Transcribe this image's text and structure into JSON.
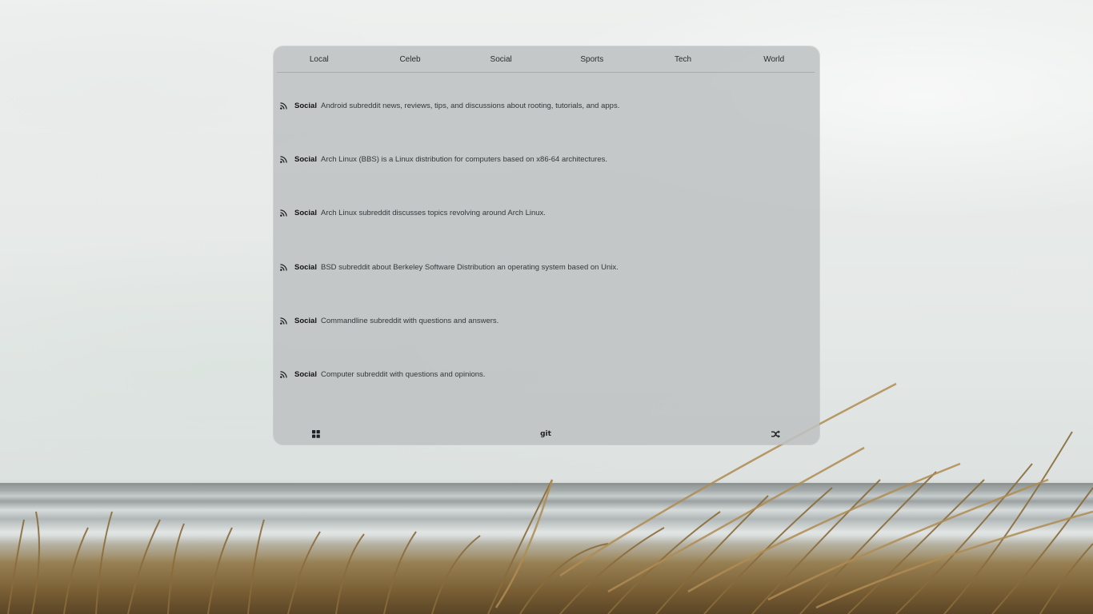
{
  "tabs": [
    {
      "label": "Local"
    },
    {
      "label": "Celeb"
    },
    {
      "label": "Social"
    },
    {
      "label": "Sports"
    },
    {
      "label": "Tech"
    },
    {
      "label": "World"
    }
  ],
  "feed": {
    "icon": "rss-icon",
    "items": [
      {
        "category": "Social",
        "description": "Android subreddit news, reviews, tips, and discussions about rooting, tutorials, and apps."
      },
      {
        "category": "Social",
        "description": "Arch Linux (BBS) is a Linux distribution for computers based on x86-64 architectures."
      },
      {
        "category": "Social",
        "description": "Arch Linux subreddit discusses topics revolving around Arch Linux."
      },
      {
        "category": "Social",
        "description": "BSD subreddit about Berkeley Software Distribution an operating system based on Unix."
      },
      {
        "category": "Social",
        "description": "Commandline subreddit with questions and answers."
      },
      {
        "category": "Social",
        "description": "Computer subreddit with questions and opinions."
      }
    ]
  },
  "footer": {
    "grid_icon": "grid-icon",
    "git_label": "git",
    "shuffle_icon": "shuffle-icon"
  },
  "colors": {
    "panel": "#bec1c2",
    "text": "#2a2d2f",
    "category": "#111111"
  }
}
